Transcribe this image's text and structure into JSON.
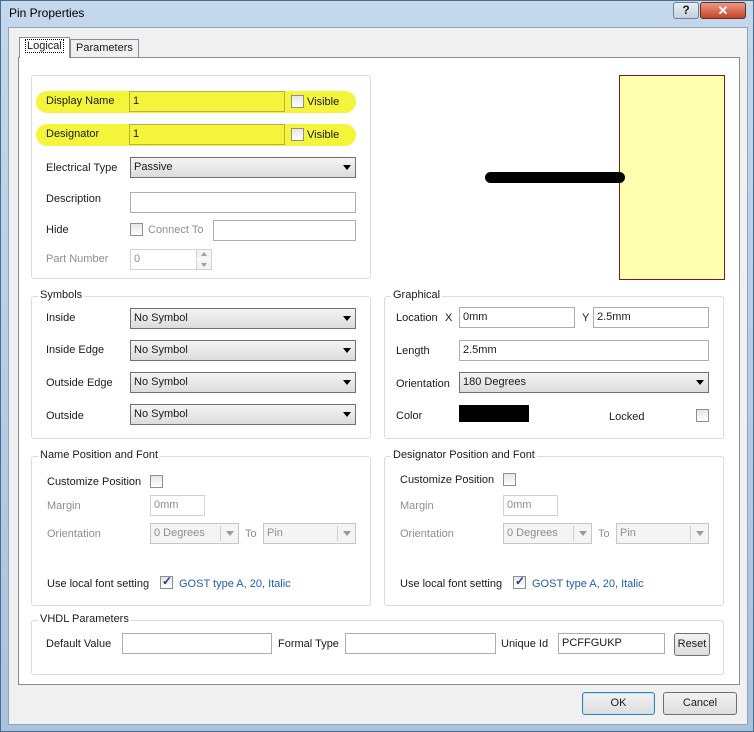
{
  "window": {
    "title": "Pin Properties",
    "help": "?",
    "close": "✕"
  },
  "tabs": [
    {
      "label": "Logical"
    },
    {
      "label": "Parameters"
    }
  ],
  "pin": {
    "display_name_label": "Display Name",
    "display_name_value": "1",
    "visible_label": "Visible",
    "designator_label": "Designator",
    "designator_value": "1",
    "electrical_type_label": "Electrical Type",
    "electrical_type_value": "Passive",
    "description_label": "Description",
    "description_value": "",
    "hide_label": "Hide",
    "connect_to_label": "Connect To",
    "connect_to_value": "",
    "part_number_label": "Part Number",
    "part_number_value": "0"
  },
  "preview": {
    "body_color": "#ffffb0",
    "body_border": "#7a1a1a",
    "pin_color": "#000000"
  },
  "symbols": {
    "title": "Symbols",
    "rows": [
      {
        "label": "Inside",
        "value": "No Symbol"
      },
      {
        "label": "Inside Edge",
        "value": "No Symbol"
      },
      {
        "label": "Outside Edge",
        "value": "No Symbol"
      },
      {
        "label": "Outside",
        "value": "No Symbol"
      }
    ]
  },
  "graphical": {
    "title": "Graphical",
    "location_label": "Location",
    "x_label": "X",
    "x_value": "0mm",
    "y_label": "Y",
    "y_value": "2.5mm",
    "length_label": "Length",
    "length_value": "2.5mm",
    "orientation_label": "Orientation",
    "orientation_value": "180 Degrees",
    "color_label": "Color",
    "color_value": "#000000",
    "locked_label": "Locked"
  },
  "name_font": {
    "title": "Name Position and Font",
    "customize_label": "Customize Position",
    "margin_label": "Margin",
    "margin_value": "0mm",
    "orientation_label": "Orientation",
    "orientation_value": "0 Degrees",
    "to_label": "To",
    "to_value": "Pin",
    "local_font_label": "Use local font setting",
    "font_link": "GOST type A, 20, Italic"
  },
  "designator_font": {
    "title": "Designator Position and Font",
    "customize_label": "Customize Position",
    "margin_label": "Margin",
    "margin_value": "0mm",
    "orientation_label": "Orientation",
    "orientation_value": "0 Degrees",
    "to_label": "To",
    "to_value": "Pin",
    "local_font_label": "Use local font setting",
    "font_link": "GOST type A, 20, Italic"
  },
  "vhdl": {
    "title": "VHDL Parameters",
    "default_value_label": "Default Value",
    "default_value": "",
    "formal_type_label": "Formal Type",
    "formal_type": "",
    "unique_id_label": "Unique Id",
    "unique_id": "PCFFGUKP",
    "reset_label": "Reset"
  },
  "footer": {
    "ok_label": "OK",
    "cancel_label": "Cancel"
  },
  "colors": {
    "highlight": "#f4f43a",
    "link": "#1f5fb4"
  }
}
